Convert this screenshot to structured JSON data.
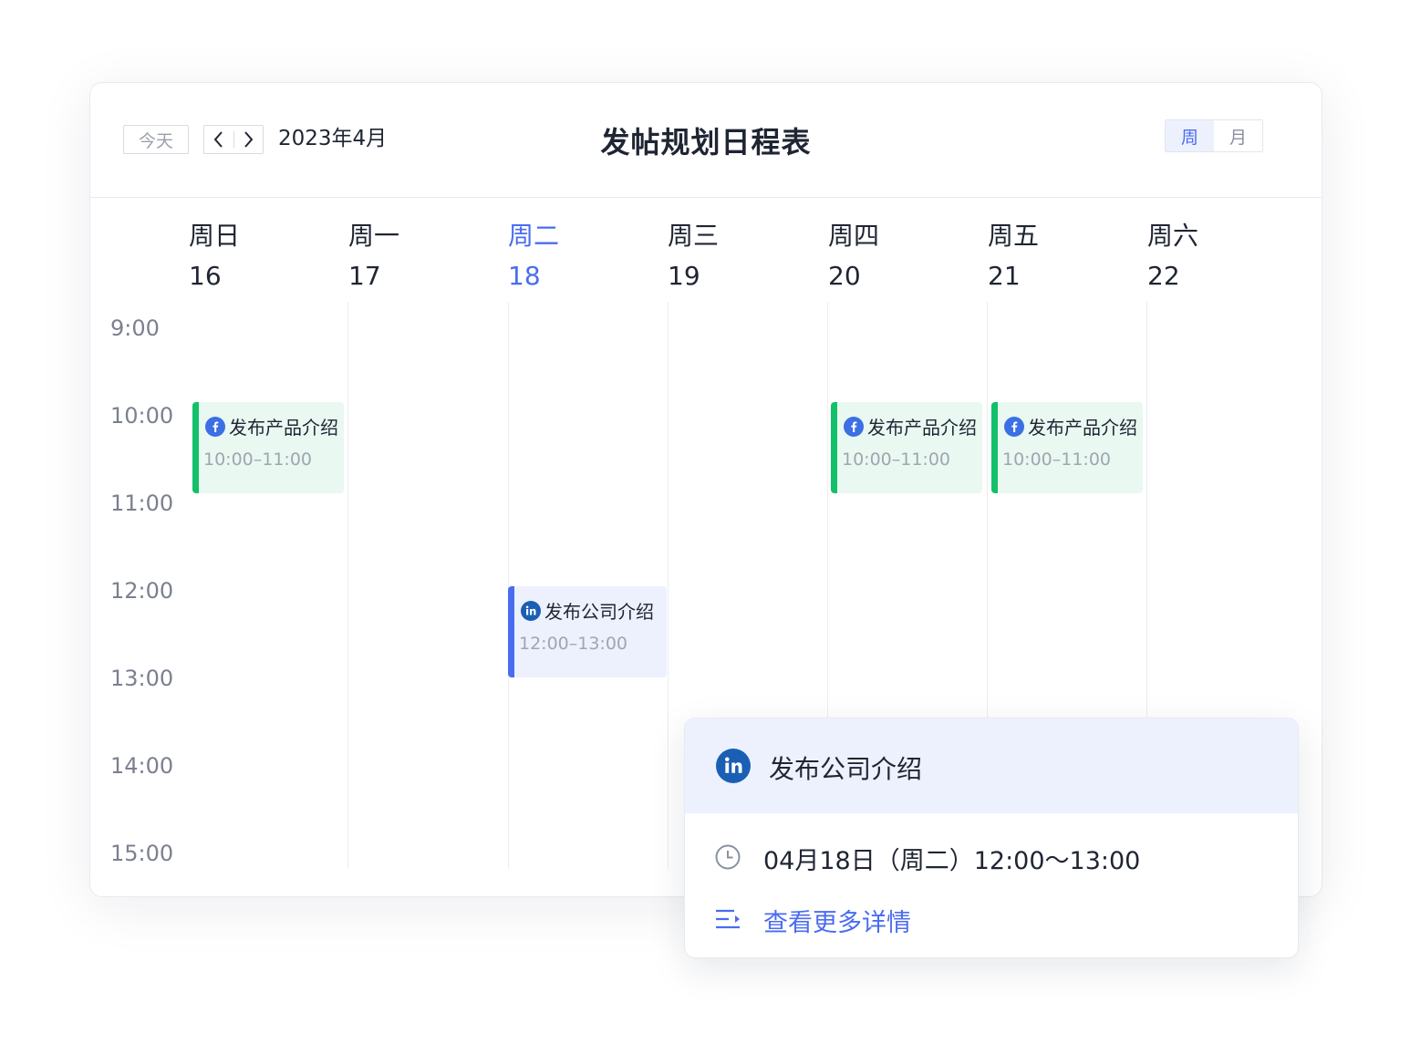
{
  "toolbar": {
    "today_label": "今天",
    "month_label": "2023年4月",
    "title": "发帖规划日程表",
    "view_options": [
      {
        "label": "周",
        "active": true
      },
      {
        "label": "月",
        "active": false
      }
    ]
  },
  "days": [
    {
      "name": "周日",
      "num": "16",
      "today": false
    },
    {
      "name": "周一",
      "num": "17",
      "today": false
    },
    {
      "name": "周二",
      "num": "18",
      "today": true
    },
    {
      "name": "周三",
      "num": "19",
      "today": false
    },
    {
      "name": "周四",
      "num": "20",
      "today": false
    },
    {
      "name": "周五",
      "num": "21",
      "today": false
    },
    {
      "name": "周六",
      "num": "22",
      "today": false
    }
  ],
  "times": [
    "9:00",
    "10:00",
    "11:00",
    "12:00",
    "13:00",
    "14:00",
    "15:00"
  ],
  "events": [
    {
      "day": "周日",
      "platform": "facebook-icon",
      "title": "发布产品介绍",
      "time": "10:00–11:00",
      "color": "#12c06a"
    },
    {
      "day": "周二",
      "platform": "linkedin-icon",
      "title": "发布公司介绍",
      "time": "12:00–13:00",
      "color": "#4a6cf0"
    },
    {
      "day": "周四",
      "platform": "facebook-icon",
      "title": "发布产品介绍",
      "time": "10:00–11:00",
      "color": "#12c06a"
    },
    {
      "day": "周五",
      "platform": "facebook-icon",
      "title": "发布产品介绍",
      "time": "10:00–11:00",
      "color": "#12c06a"
    }
  ],
  "popover": {
    "platform": "linkedin-icon",
    "title": "发布公司介绍",
    "datetime": "04月18日（周二）12:00～13:00",
    "more_label": "查看更多详情"
  },
  "colors": {
    "accent": "#4a6cf0",
    "event_green": "#12c06a",
    "facebook": "#3b6fe6",
    "linkedin": "#1a5fb4"
  }
}
